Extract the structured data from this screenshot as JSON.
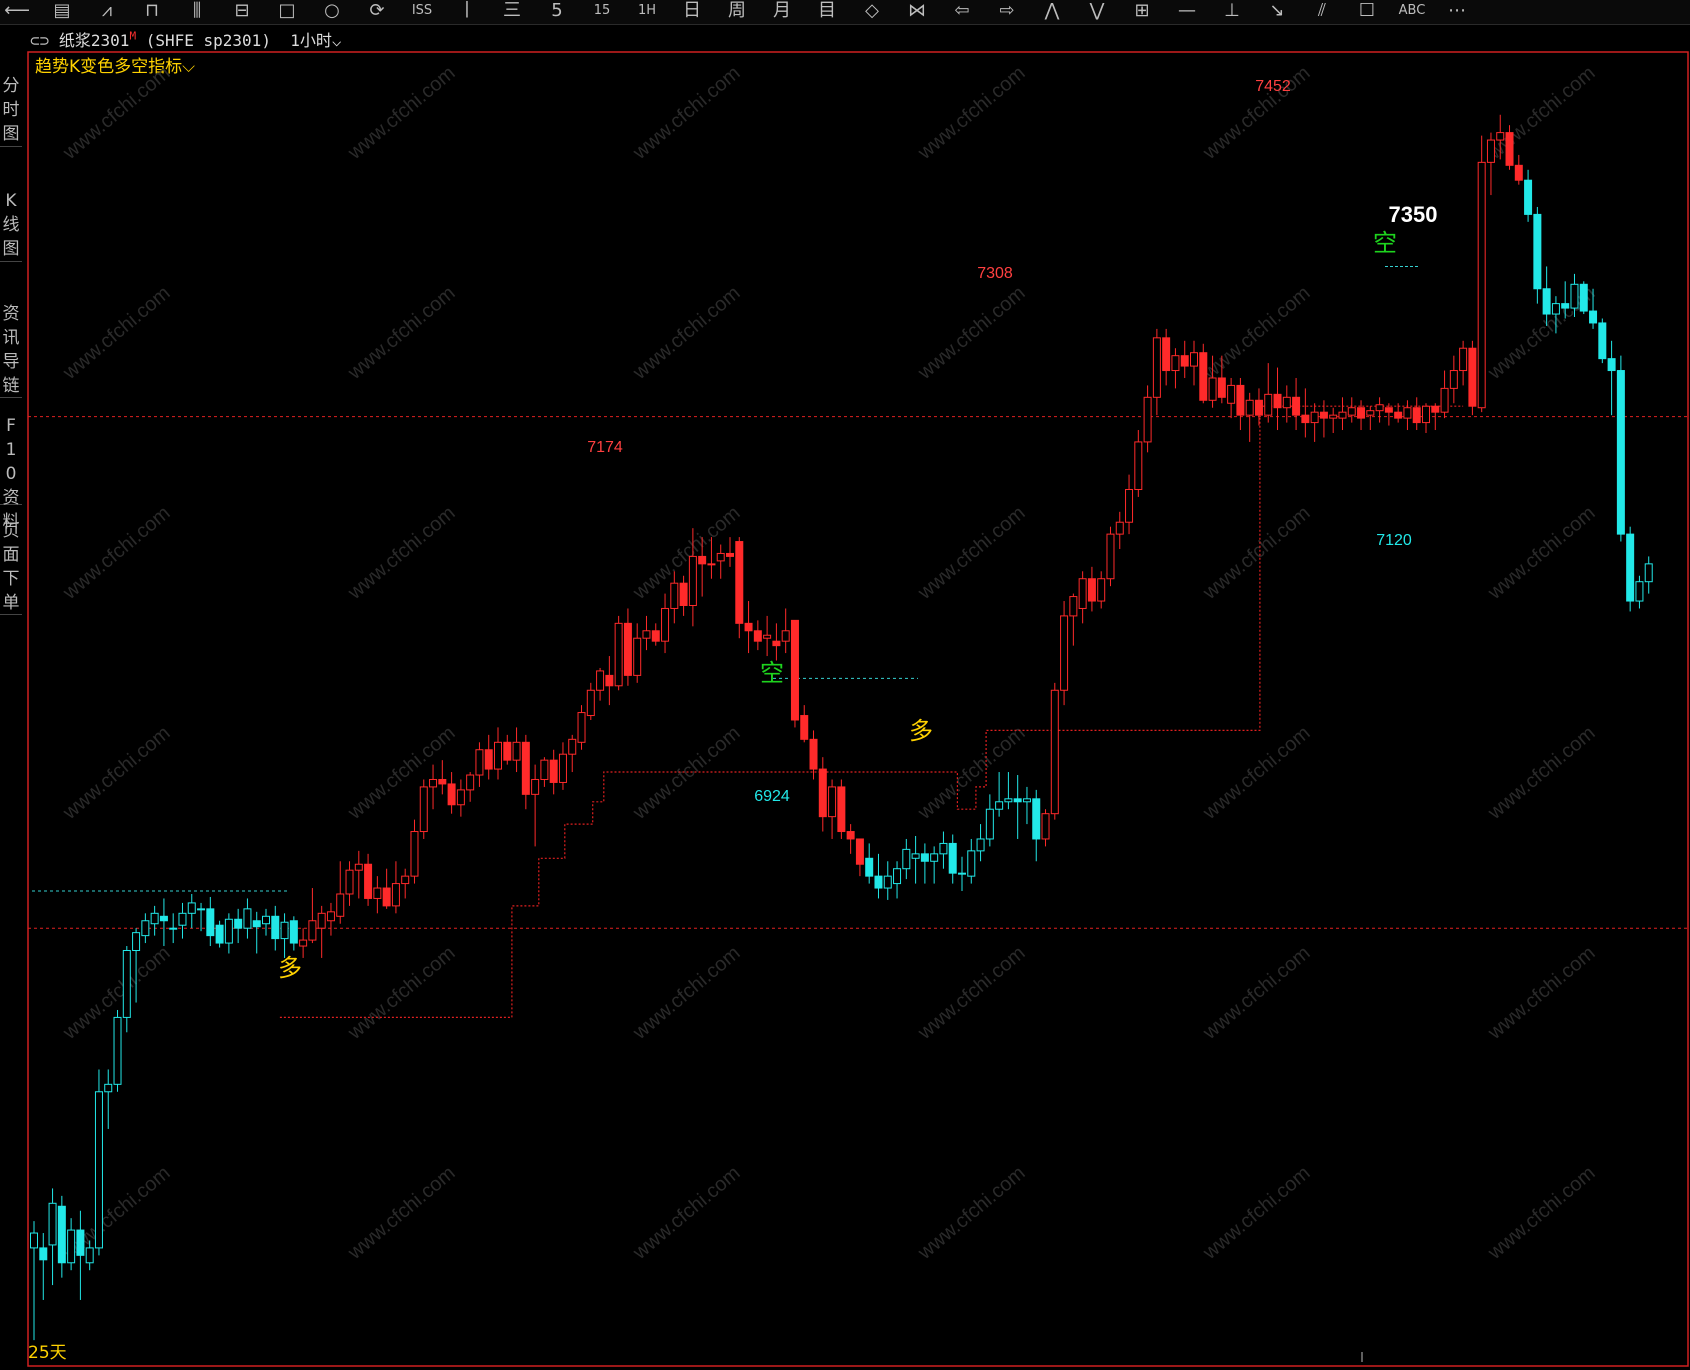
{
  "toolbar": {
    "icons": [
      "back-arrow-icon",
      "list-icon",
      "line-chart-icon",
      "candle-icon",
      "volume-icon",
      "window-icon",
      "box-icon",
      "circle-icon",
      "refresh-icon",
      "iss-icon",
      "tick-icon",
      "min3-icon",
      "min5-icon",
      "min15-icon",
      "min60-icon",
      "day-icon",
      "week-icon",
      "month-icon",
      "multi-icon",
      "zoom-out-h-icon",
      "zoom-in-h-icon",
      "prev-icon",
      "next-icon",
      "collapse-up-icon",
      "collapse-down-icon",
      "layout-icon",
      "hline-icon",
      "vline-icon",
      "ray-icon",
      "channel-icon",
      "rect-icon",
      "text-icon",
      "more-icon"
    ],
    "glyphs": [
      "⟵",
      "▤",
      "⩘",
      "⊓",
      "⫼",
      "⊟",
      "□",
      "○",
      "⟳",
      "ISS",
      "丨",
      "三",
      "5",
      "15",
      "1H",
      "日",
      "周",
      "月",
      "目",
      "◇",
      "⋈",
      "⇦",
      "⇨",
      "⋀",
      "⋁",
      "⊞",
      "—",
      "⊥",
      "↘",
      "⫽",
      "☐",
      "ABC",
      "⋯"
    ]
  },
  "sidebar": {
    "items": [
      {
        "label": "分时图"
      },
      {
        "label": "K线图"
      },
      {
        "label": "资讯导链"
      },
      {
        "label": "F10资料"
      },
      {
        "label": "页面下单"
      }
    ]
  },
  "infobar": {
    "symbol": "纸浆2301",
    "flag": "M",
    "code": "(SHFE  sp2301)",
    "period": "1小时",
    "dropdown": "⌵"
  },
  "indicator": {
    "name": "趋势K变色多空指标",
    "dropdown": "⌵"
  },
  "bottom": {
    "days": "25天"
  },
  "watermark": "www.cfchi.com",
  "colors": {
    "up": "#ff2a2a",
    "down": "#22e8e8",
    "long_signal": "#ffd200",
    "short_signal": "#1ed41e",
    "support_line": "#e02020",
    "ref_line_cyan": "#35d0d0",
    "price_label_high": "#ff4040",
    "price_label_low": "#22e8e8"
  },
  "chart_data": {
    "type": "candlestick",
    "title": "纸浆2301 1小时",
    "ylim": [
      6620,
      7470
    ],
    "annotations": {
      "high_1": "7174",
      "high_2": "7308",
      "high_3": "7452",
      "low_1": "6924",
      "low_2": "7120",
      "latest_signal_price": "7350",
      "signal_long": "多",
      "signal_short": "空"
    },
    "ohlc": [
      [
        6690,
        6708,
        6628,
        6700
      ],
      [
        6690,
        6700,
        6655,
        6682
      ],
      [
        6692,
        6730,
        6665,
        6720
      ],
      [
        6718,
        6725,
        6670,
        6680
      ],
      [
        6680,
        6710,
        6675,
        6702
      ],
      [
        6702,
        6715,
        6655,
        6685
      ],
      [
        6680,
        6695,
        6675,
        6690
      ],
      [
        6690,
        6810,
        6685,
        6795
      ],
      [
        6795,
        6810,
        6770,
        6800
      ],
      [
        6800,
        6850,
        6795,
        6845
      ],
      [
        6845,
        6893,
        6835,
        6890
      ],
      [
        6890,
        6905,
        6855,
        6902
      ],
      [
        6900,
        6915,
        6895,
        6910
      ],
      [
        6908,
        6920,
        6900,
        6915
      ],
      [
        6913,
        6925,
        6893,
        6910
      ],
      [
        6905,
        6915,
        6895,
        6905
      ],
      [
        6907,
        6922,
        6898,
        6915
      ],
      [
        6915,
        6928,
        6905,
        6922
      ],
      [
        6918,
        6922,
        6903,
        6918
      ],
      [
        6918,
        6926,
        6893,
        6900
      ],
      [
        6907,
        6910,
        6892,
        6895
      ],
      [
        6895,
        6915,
        6888,
        6911
      ],
      [
        6911,
        6918,
        6895,
        6905
      ],
      [
        6905,
        6925,
        6898,
        6918
      ],
      [
        6910,
        6916,
        6888,
        6906
      ],
      [
        6908,
        6918,
        6900,
        6913
      ],
      [
        6913,
        6920,
        6890,
        6898
      ],
      [
        6898,
        6915,
        6885,
        6909
      ],
      [
        6910,
        6913,
        6890,
        6895
      ],
      [
        6893,
        6905,
        6885,
        6897
      ],
      [
        6897,
        6932,
        6895,
        6910
      ],
      [
        6905,
        6920,
        6885,
        6915
      ],
      [
        6910,
        6922,
        6900,
        6916
      ],
      [
        6913,
        6950,
        6908,
        6928
      ],
      [
        6928,
        6950,
        6920,
        6944
      ],
      [
        6944,
        6957,
        6925,
        6948
      ],
      [
        6948,
        6955,
        6920,
        6925
      ],
      [
        6925,
        6940,
        6915,
        6932
      ],
      [
        6932,
        6945,
        6918,
        6920
      ],
      [
        6920,
        6950,
        6915,
        6935
      ],
      [
        6935,
        6945,
        6925,
        6940
      ],
      [
        6940,
        6978,
        6935,
        6970
      ],
      [
        6970,
        7005,
        6965,
        7000
      ],
      [
        7000,
        7015,
        6985,
        7005
      ],
      [
        7005,
        7018,
        6995,
        7002
      ],
      [
        7002,
        7010,
        6982,
        6988
      ],
      [
        6988,
        7005,
        6980,
        6998
      ],
      [
        6998,
        7010,
        6990,
        7008
      ],
      [
        7008,
        7030,
        7000,
        7025
      ],
      [
        7025,
        7035,
        7005,
        7012
      ],
      [
        7012,
        7040,
        7005,
        7030
      ],
      [
        7030,
        7035,
        7015,
        7018
      ],
      [
        7018,
        7040,
        7010,
        7030
      ],
      [
        7030,
        7035,
        6985,
        6995
      ],
      [
        6995,
        7015,
        6960,
        7005
      ],
      [
        7005,
        7020,
        7000,
        7018
      ],
      [
        7018,
        7025,
        6995,
        7003
      ],
      [
        7003,
        7030,
        6998,
        7022
      ],
      [
        7022,
        7035,
        7010,
        7032
      ],
      [
        7030,
        7055,
        7025,
        7050
      ],
      [
        7048,
        7070,
        7045,
        7065
      ],
      [
        7065,
        7080,
        7058,
        7078
      ],
      [
        7075,
        7088,
        7055,
        7068
      ],
      [
        7068,
        7115,
        7065,
        7110
      ],
      [
        7110,
        7120,
        7068,
        7075
      ],
      [
        7075,
        7110,
        7070,
        7100
      ],
      [
        7100,
        7115,
        7092,
        7105
      ],
      [
        7105,
        7110,
        7095,
        7098
      ],
      [
        7098,
        7130,
        7090,
        7120
      ],
      [
        7120,
        7145,
        7110,
        7137
      ],
      [
        7137,
        7142,
        7115,
        7122
      ],
      [
        7122,
        7174,
        7108,
        7155
      ],
      [
        7155,
        7168,
        7128,
        7150
      ],
      [
        7150,
        7168,
        7140,
        7150
      ],
      [
        7152,
        7163,
        7140,
        7157
      ],
      [
        7157,
        7168,
        7148,
        7155
      ],
      [
        7165,
        7168,
        7100,
        7110
      ],
      [
        7110,
        7125,
        7090,
        7105
      ],
      [
        7105,
        7112,
        7092,
        7098
      ],
      [
        7100,
        7115,
        7088,
        7102
      ],
      [
        7098,
        7110,
        7085,
        7095
      ],
      [
        7098,
        7120,
        7090,
        7105
      ],
      [
        7112,
        7112,
        7040,
        7045
      ],
      [
        7048,
        7055,
        7030,
        7032
      ],
      [
        7032,
        7038,
        7005,
        7012
      ],
      [
        7012,
        7020,
        6970,
        6980
      ],
      [
        6980,
        7005,
        6965,
        7000
      ],
      [
        7000,
        7005,
        6965,
        6970
      ],
      [
        6970,
        6975,
        6955,
        6965
      ],
      [
        6965,
        6965,
        6940,
        6948
      ],
      [
        6952,
        6962,
        6935,
        6940
      ],
      [
        6940,
        6955,
        6925,
        6932
      ],
      [
        6932,
        6950,
        6924,
        6940
      ],
      [
        6935,
        6950,
        6925,
        6945
      ],
      [
        6945,
        6965,
        6938,
        6958
      ],
      [
        6952,
        6967,
        6935,
        6955
      ],
      [
        6955,
        6962,
        6935,
        6950
      ],
      [
        6950,
        6960,
        6935,
        6955
      ],
      [
        6955,
        6970,
        6945,
        6962
      ],
      [
        6962,
        6968,
        6935,
        6942
      ],
      [
        6942,
        6953,
        6930,
        6942
      ],
      [
        6940,
        6965,
        6935,
        6957
      ],
      [
        6957,
        6975,
        6950,
        6965
      ],
      [
        6965,
        6995,
        6960,
        6985
      ],
      [
        6985,
        7010,
        6980,
        6990
      ],
      [
        6990,
        7010,
        6985,
        6992
      ],
      [
        6992,
        7008,
        6965,
        6990
      ],
      [
        6990,
        7000,
        6975,
        6992
      ],
      [
        6992,
        6998,
        6950,
        6965
      ],
      [
        6965,
        6985,
        6960,
        6982
      ],
      [
        6982,
        7070,
        6978,
        7065
      ],
      [
        7065,
        7125,
        7055,
        7115
      ],
      [
        7115,
        7130,
        7095,
        7128
      ],
      [
        7120,
        7145,
        7110,
        7140
      ],
      [
        7140,
        7148,
        7118,
        7125
      ],
      [
        7125,
        7145,
        7120,
        7140
      ],
      [
        7140,
        7175,
        7135,
        7170
      ],
      [
        7170,
        7185,
        7160,
        7178
      ],
      [
        7178,
        7210,
        7170,
        7200
      ],
      [
        7200,
        7240,
        7195,
        7232
      ],
      [
        7232,
        7270,
        7225,
        7262
      ],
      [
        7262,
        7308,
        7250,
        7302
      ],
      [
        7302,
        7308,
        7270,
        7280
      ],
      [
        7280,
        7295,
        7268,
        7290
      ],
      [
        7290,
        7300,
        7275,
        7283
      ],
      [
        7283,
        7300,
        7270,
        7292
      ],
      [
        7292,
        7298,
        7258,
        7260
      ],
      [
        7260,
        7290,
        7255,
        7275
      ],
      [
        7275,
        7290,
        7258,
        7262
      ],
      [
        7258,
        7275,
        7248,
        7270
      ],
      [
        7270,
        7275,
        7240,
        7250
      ],
      [
        7250,
        7265,
        7232,
        7260
      ],
      [
        7260,
        7268,
        7243,
        7250
      ],
      [
        7250,
        7285,
        7245,
        7264
      ],
      [
        7264,
        7282,
        7240,
        7255
      ],
      [
        7255,
        7270,
        7245,
        7262
      ],
      [
        7262,
        7275,
        7240,
        7250
      ],
      [
        7250,
        7268,
        7235,
        7245
      ],
      [
        7245,
        7258,
        7232,
        7252
      ],
      [
        7252,
        7260,
        7235,
        7248
      ],
      [
        7248,
        7255,
        7238,
        7250
      ],
      [
        7248,
        7262,
        7240,
        7252
      ],
      [
        7250,
        7262,
        7245,
        7255
      ],
      [
        7255,
        7260,
        7240,
        7248
      ],
      [
        7250,
        7256,
        7240,
        7253
      ],
      [
        7253,
        7262,
        7245,
        7257
      ],
      [
        7255,
        7258,
        7243,
        7252
      ],
      [
        7252,
        7258,
        7245,
        7248
      ],
      [
        7248,
        7260,
        7240,
        7255
      ],
      [
        7255,
        7262,
        7240,
        7245
      ],
      [
        7245,
        7258,
        7238,
        7256
      ],
      [
        7256,
        7258,
        7240,
        7252
      ],
      [
        7252,
        7280,
        7248,
        7268
      ],
      [
        7268,
        7290,
        7258,
        7280
      ],
      [
        7280,
        7300,
        7270,
        7295
      ],
      [
        7295,
        7300,
        7250,
        7256
      ],
      [
        7255,
        7438,
        7252,
        7420
      ],
      [
        7420,
        7440,
        7398,
        7435
      ],
      [
        7435,
        7452,
        7422,
        7440
      ],
      [
        7440,
        7445,
        7415,
        7418
      ],
      [
        7418,
        7425,
        7405,
        7408
      ],
      [
        7408,
        7415,
        7380,
        7385
      ],
      [
        7385,
        7390,
        7325,
        7335
      ],
      [
        7335,
        7350,
        7310,
        7318
      ],
      [
        7318,
        7330,
        7305,
        7325
      ],
      [
        7325,
        7340,
        7315,
        7322
      ],
      [
        7322,
        7345,
        7316,
        7338
      ],
      [
        7338,
        7340,
        7318,
        7320
      ],
      [
        7320,
        7335,
        7308,
        7312
      ],
      [
        7312,
        7315,
        7285,
        7288
      ],
      [
        7288,
        7300,
        7250,
        7280
      ],
      [
        7280,
        7290,
        7165,
        7170
      ],
      [
        7170,
        7175,
        7118,
        7125
      ],
      [
        7125,
        7142,
        7120,
        7138
      ],
      [
        7138,
        7155,
        7130,
        7150
      ]
    ]
  }
}
